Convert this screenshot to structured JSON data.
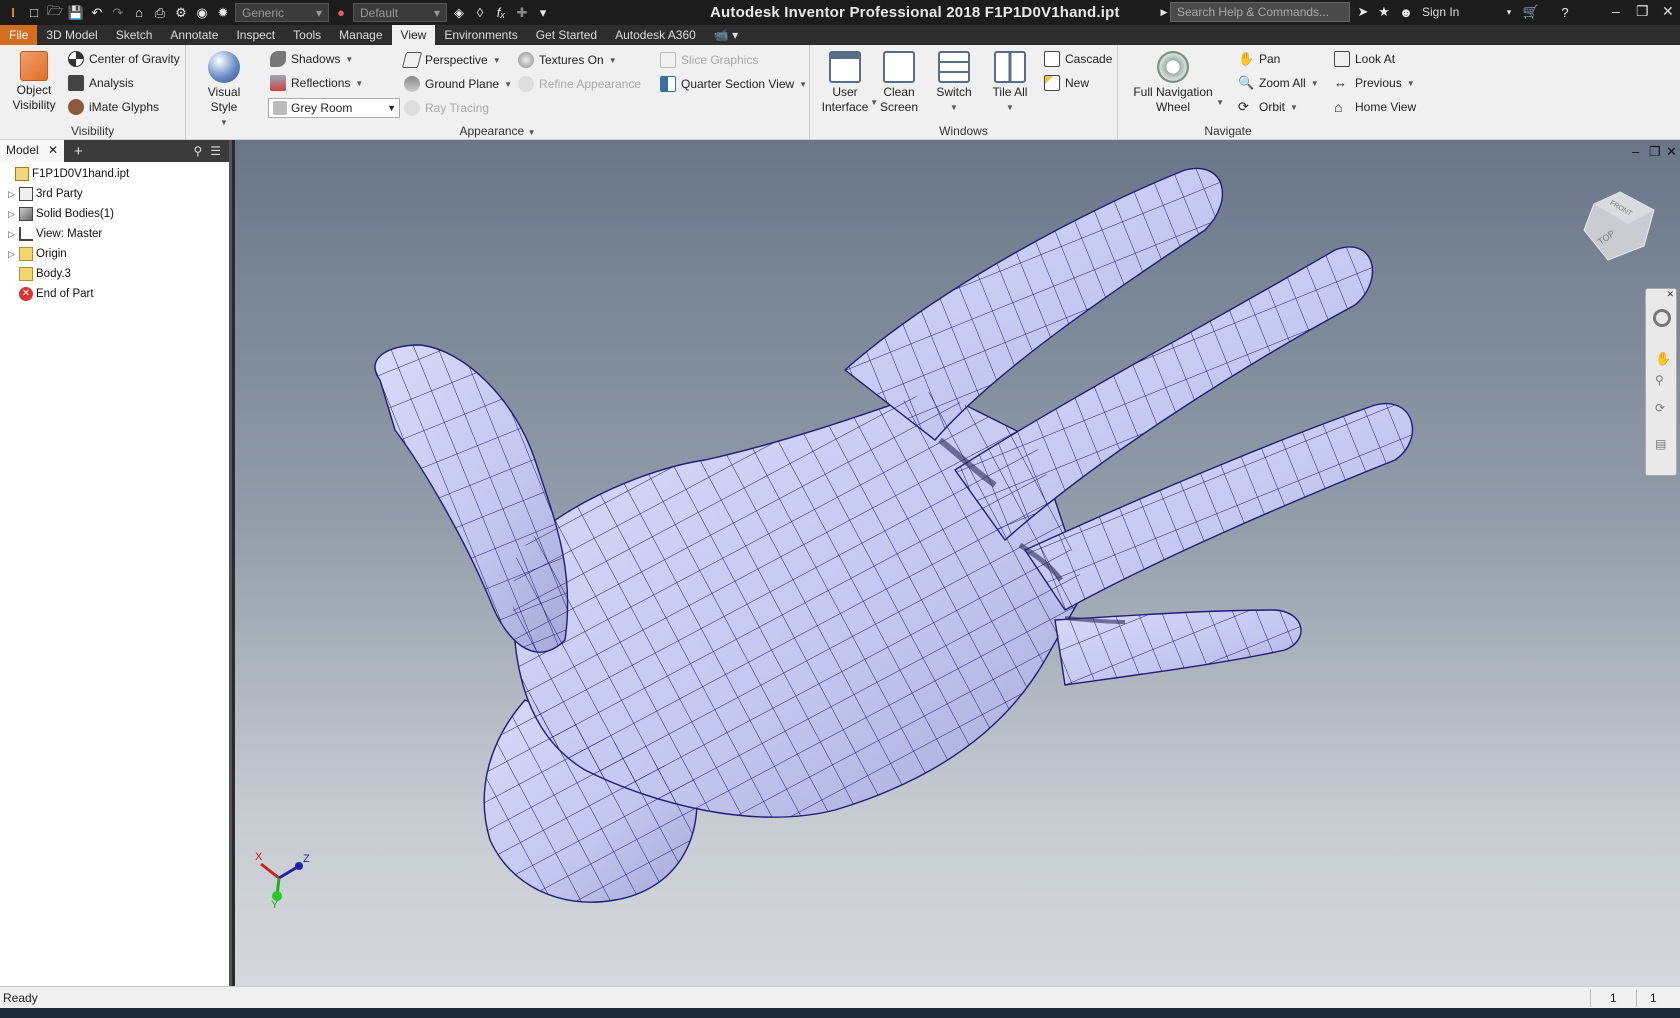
{
  "app": {
    "title": "Autodesk Inventor Professional 2018    F1P1D0V1hand.ipt",
    "search_placeholder": "Search Help & Commands...",
    "sign_in": "Sign In"
  },
  "quick_access": {
    "material": "Generic",
    "appearance": "Default"
  },
  "tabs": [
    "File",
    "3D Model",
    "Sketch",
    "Annotate",
    "Inspect",
    "Tools",
    "Manage",
    "View",
    "Environments",
    "Get Started",
    "Autodesk A360"
  ],
  "active_tab": "View",
  "ribbon": {
    "visibility": {
      "label": "Visibility",
      "object_visibility": "Object Visibility",
      "center_of_gravity": "Center of Gravity",
      "analysis": "Analysis",
      "imate_glyphs": "iMate Glyphs"
    },
    "appearance": {
      "label": "Appearance",
      "visual_style": "Visual Style",
      "shadows": "Shadows",
      "reflections": "Reflections",
      "environment": "Grey Room",
      "perspective": "Perspective",
      "ground_plane": "Ground Plane",
      "ray_tracing": "Ray Tracing",
      "textures_on": "Textures On",
      "refine_appearance": "Refine Appearance",
      "slice_graphics": "Slice Graphics",
      "quarter_section": "Quarter Section View"
    },
    "windows": {
      "label": "Windows",
      "user_interface": "User Interface",
      "clean_screen": "Clean Screen",
      "switch": "Switch",
      "tile_all": "Tile All",
      "cascade": "Cascade",
      "new": "New"
    },
    "navigate": {
      "label": "Navigate",
      "full_nav_wheel": "Full Navigation Wheel",
      "pan": "Pan",
      "zoom_all": "Zoom All",
      "orbit": "Orbit",
      "look_at": "Look At",
      "previous": "Previous",
      "home_view": "Home View"
    }
  },
  "browser": {
    "tab": "Model",
    "items": [
      {
        "label": "F1P1D0V1hand.ipt",
        "expand": false,
        "icon": "part-icon"
      },
      {
        "label": "3rd Party",
        "expand": true,
        "icon": "third-party-icon"
      },
      {
        "label": "Solid Bodies(1)",
        "expand": true,
        "icon": "solid-bodies-icon"
      },
      {
        "label": "View: Master",
        "expand": true,
        "icon": "view-icon"
      },
      {
        "label": "Origin",
        "expand": true,
        "icon": "folder-icon"
      },
      {
        "label": "Body.3",
        "expand": false,
        "icon": "body-icon"
      },
      {
        "label": "End of Part",
        "expand": false,
        "icon": "end-of-part-icon"
      }
    ]
  },
  "viewcube": {
    "top": "TOP",
    "front": "FRONT"
  },
  "triad": {
    "x": "X",
    "y": "Y",
    "z": "Z"
  },
  "status": {
    "text": "Ready",
    "count1": "1",
    "count2": "1"
  },
  "colors": {
    "file_tab": "#d56d1e",
    "mesh": "#1c1e7a",
    "surface": "#c3c6ef"
  }
}
